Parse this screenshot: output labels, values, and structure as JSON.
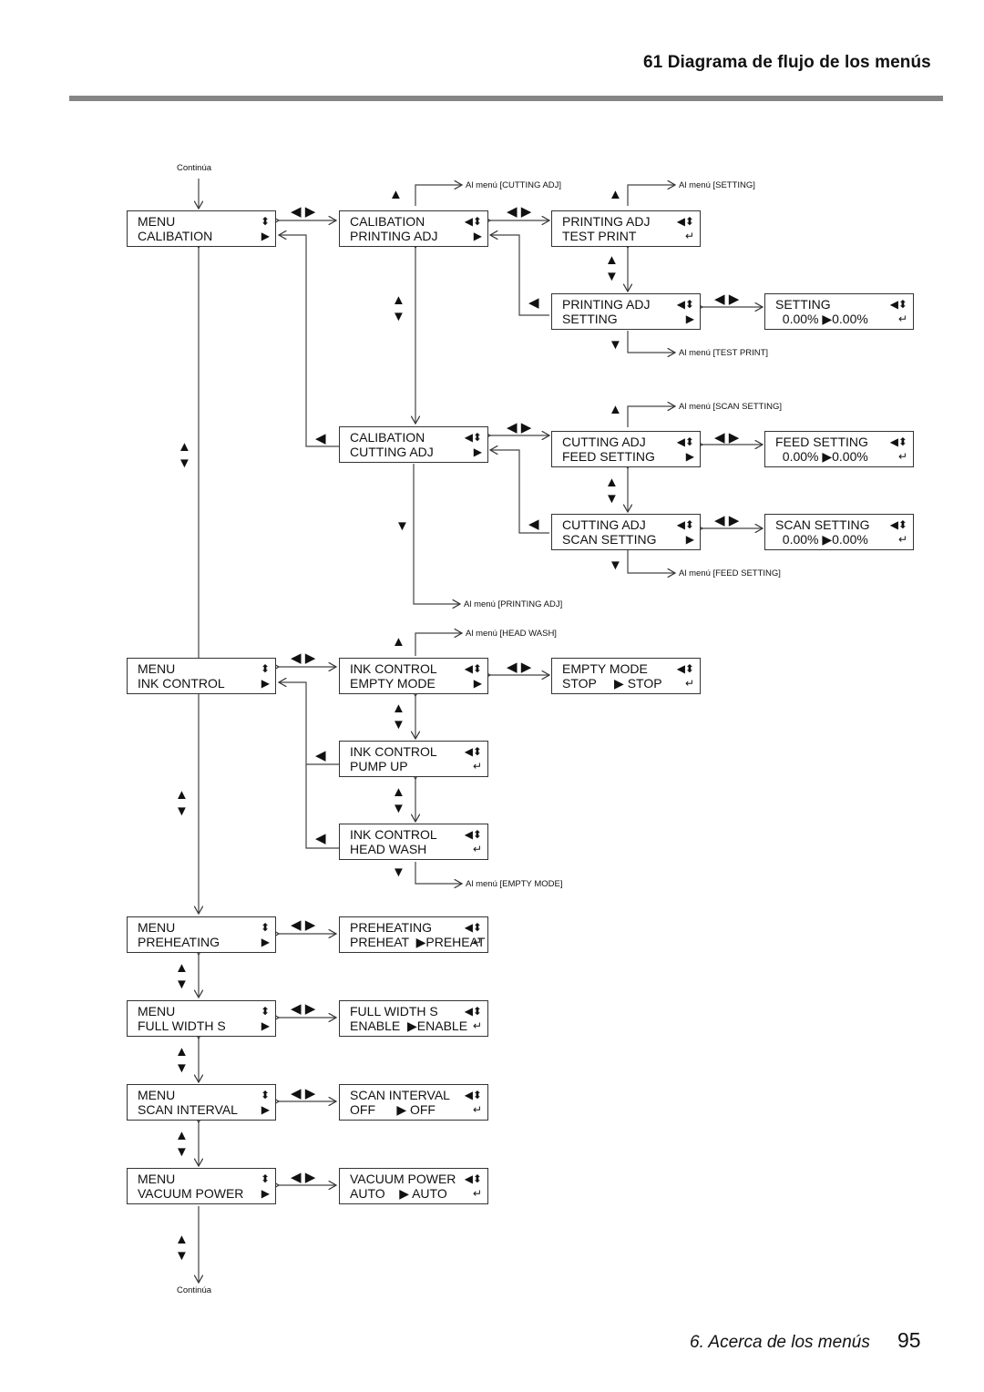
{
  "header": {
    "title": "61 Diagrama de flujo de los menús"
  },
  "notes": {
    "continua_top": "Continúa",
    "continua_bottom": "Continúa",
    "to_cutting_adj": "Al menú [CUTTING ADJ]",
    "to_setting": "Al menú [SETTING]",
    "to_test_print": "Al menú [TEST PRINT]",
    "to_scan_setting": "Al menú [SCAN SETTING]",
    "to_feed_setting": "Al menú [FEED SETTING]",
    "to_printing_adj": "Al menú [PRINTING ADJ]",
    "to_head_wash": "Al menú [HEAD WASH]",
    "to_empty_mode": "Al menú [EMPTY MODE]"
  },
  "icons": {
    "updown": "⬍",
    "left_updown": "◀⬍",
    "right": "▶",
    "enter": "↵",
    "left": "◀",
    "right_arrow": "▶",
    "up": "▲",
    "down": "▼",
    "left_right": "◀ ▶"
  },
  "screens": {
    "menu_calibation": {
      "line1": "MENU",
      "line2": "CALIBATION"
    },
    "calib_printing": {
      "line1": "CALIBATION",
      "line2": "PRINTING ADJ"
    },
    "printing_testprint": {
      "line1": "PRINTING ADJ",
      "line2": "TEST PRINT"
    },
    "printing_setting": {
      "line1": "PRINTING ADJ",
      "line2": "SETTING"
    },
    "setting_value": {
      "line1": "SETTING",
      "line2": "  0.00% ▶0.00%"
    },
    "calib_cutting": {
      "line1": "CALIBATION",
      "line2": "CUTTING ADJ"
    },
    "cutting_feed": {
      "line1": "CUTTING ADJ",
      "line2": "FEED SETTING"
    },
    "feed_value": {
      "line1": "FEED SETTING",
      "line2": "  0.00% ▶0.00%"
    },
    "cutting_scan": {
      "line1": "CUTTING ADJ",
      "line2": "SCAN SETTING"
    },
    "scan_value": {
      "line1": "SCAN SETTING",
      "line2": "  0.00% ▶0.00%"
    },
    "menu_ink": {
      "line1": "MENU",
      "line2": "INK CONTROL"
    },
    "ink_empty": {
      "line1": "INK CONTROL",
      "line2": "EMPTY MODE"
    },
    "empty_value": {
      "line1": "EMPTY MODE",
      "line2": "STOP     ▶ STOP"
    },
    "ink_pump": {
      "line1": "INK CONTROL",
      "line2": "PUMP UP"
    },
    "ink_head": {
      "line1": "INK CONTROL",
      "line2": "HEAD WASH"
    },
    "menu_preheat": {
      "line1": "MENU",
      "line2": "PREHEATING"
    },
    "preheat_value": {
      "line1": "PREHEATING",
      "line2": "PREHEAT  ▶PREHEAT"
    },
    "menu_fullwidth": {
      "line1": "MENU",
      "line2": "FULL WIDTH S"
    },
    "fullwidth_value": {
      "line1": "FULL WIDTH S",
      "line2": "ENABLE  ▶ENABLE"
    },
    "menu_scaninterval": {
      "line1": "MENU",
      "line2": "SCAN INTERVAL"
    },
    "scaninterval_value": {
      "line1": "SCAN INTERVAL",
      "line2": "OFF      ▶ OFF"
    },
    "menu_vacuum": {
      "line1": "MENU",
      "line2": "VACUUM POWER"
    },
    "vacuum_value": {
      "line1": "VACUUM POWER",
      "line2": "AUTO    ▶ AUTO"
    }
  },
  "footer": {
    "section": "6. Acerca de los menús",
    "page": "95"
  }
}
